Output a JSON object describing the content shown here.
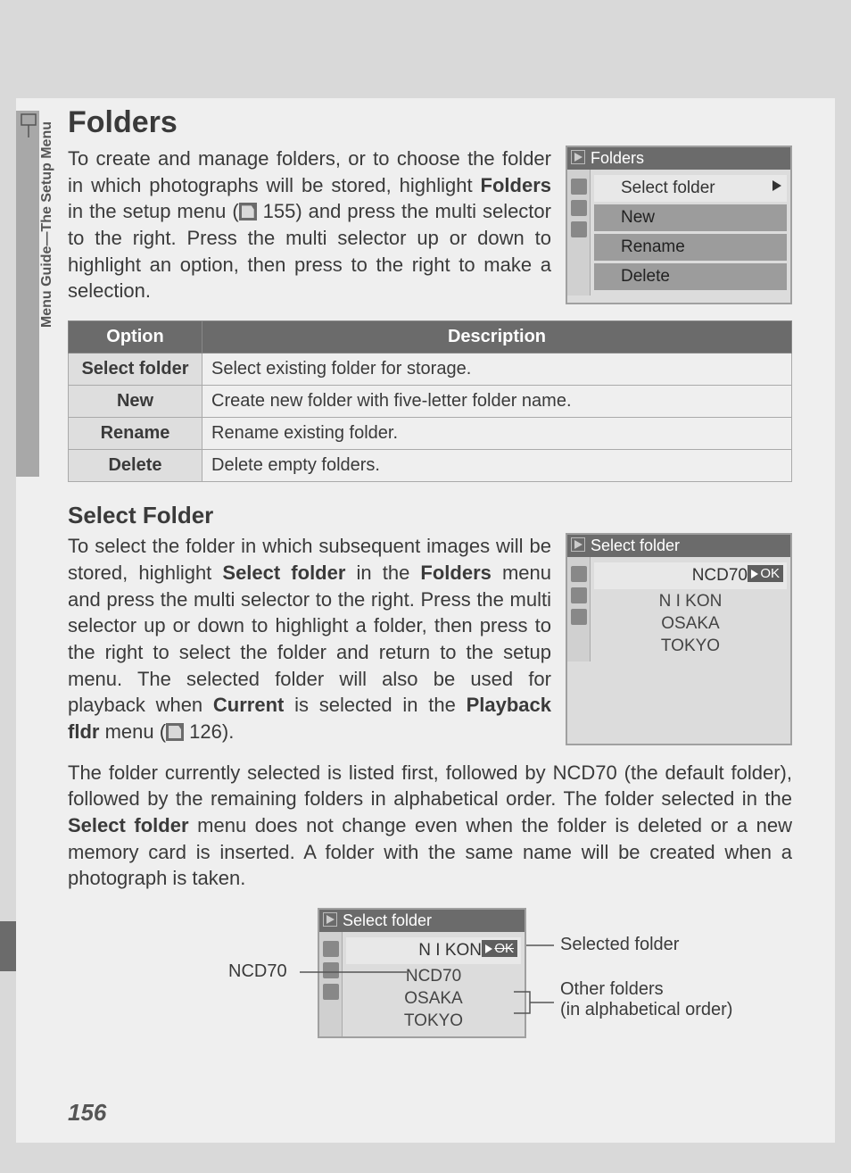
{
  "sideTab": "Menu Guide—The Setup Menu",
  "title": "Folders",
  "intro": {
    "l1": "To create and manage folders, or to choose the folder in which photographs will be stored, highlight ",
    "b1": "Folders",
    "l2": " in the setup menu (",
    "ref1": " 155) and press the multi selector to the right.  Press the multi selector up or down to highlight an option, then press to the right to make a selection."
  },
  "lcd1": {
    "title": "Folders",
    "items": [
      "Select folder",
      "New",
      "Rename",
      "Delete"
    ]
  },
  "table": {
    "head": {
      "opt": "Option",
      "desc": "Description"
    },
    "rows": [
      {
        "opt": "Select folder",
        "desc": "Select existing folder for storage."
      },
      {
        "opt": "New",
        "desc": "Create new folder with five-letter folder name."
      },
      {
        "opt": "Rename",
        "desc": "Rename existing folder."
      },
      {
        "opt": "Delete",
        "desc": "Delete empty folders."
      }
    ]
  },
  "subhead": "Select Folder",
  "sel": {
    "l1": "To select the folder in which subsequent images will be stored, highlight ",
    "b1": "Select folder",
    "l2": " in the ",
    "b2": "Folders",
    "l3": " menu and press the multi selector to the right.  Press the multi selector up or down to highlight a folder, then press to the right to select the folder and return to the setup menu.  The selected folder will also be used for playback when ",
    "b3": "Current",
    "l4": " is selected in the ",
    "b4": "Playback fldr",
    "l5": " menu (",
    "ref": " 126)."
  },
  "lcd2": {
    "title": "Select folder",
    "selected": "NCD70",
    "ok": "OK",
    "items": [
      "N I KON",
      "OSAKA",
      "TOKYO"
    ]
  },
  "para": {
    "l1": "The folder currently selected is listed first, followed by NCD70 (the default folder), followed by the remaining folders in alphabetical order.  The folder selected in the ",
    "b1": "Select folder",
    "l2": " menu does not change even when the folder is deleted or a new memory card is inserted.  A folder with the same name will be created when a photograph is taken."
  },
  "diagram": {
    "lcdTitle": "Select folder",
    "selected": "N I KON",
    "ok": "OK",
    "items": [
      "NCD70",
      "OSAKA",
      "TOKYO"
    ],
    "labelLeft": "NCD70",
    "labelRight1": "Selected folder",
    "labelRight2a": "Other folders",
    "labelRight2b": "(in alphabetical order)"
  },
  "pageNum": "156"
}
